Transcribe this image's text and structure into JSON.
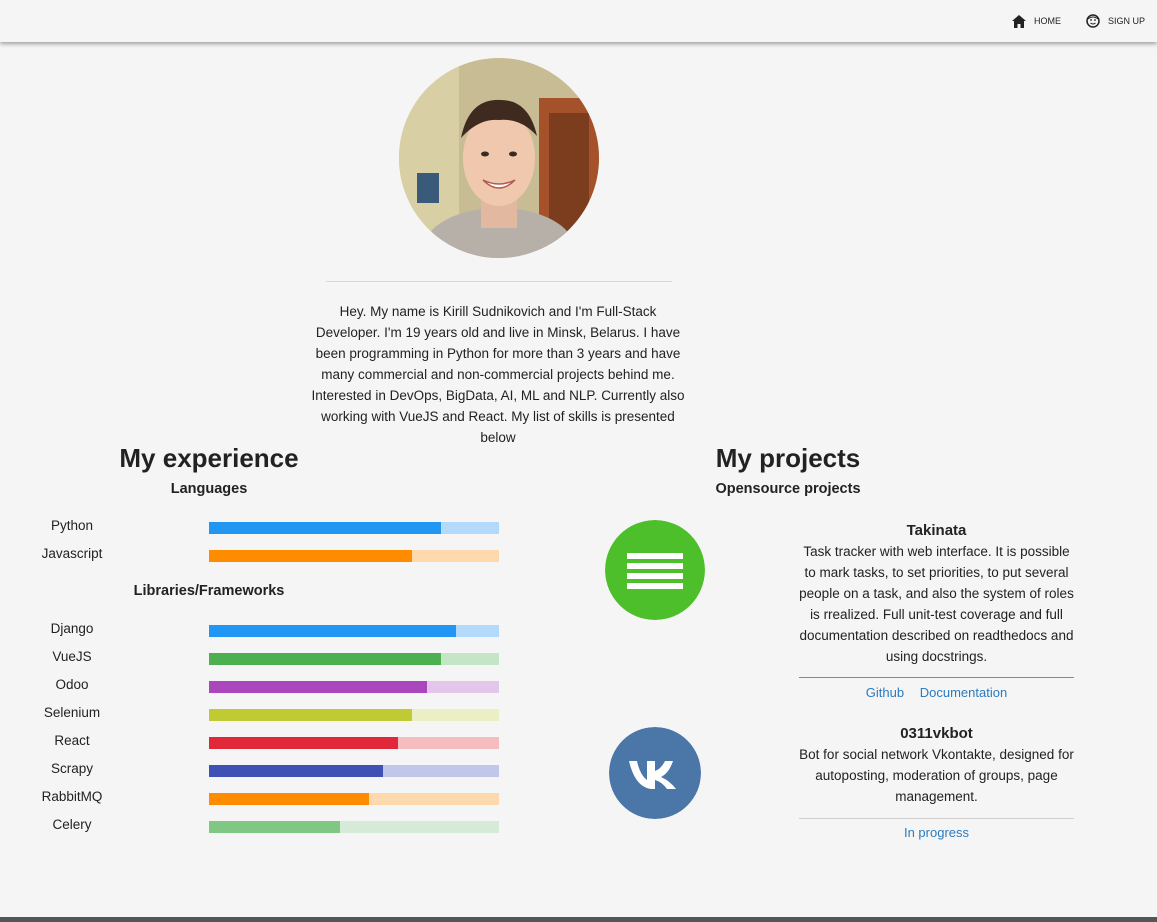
{
  "nav": {
    "home_label": "HOME",
    "signup_label": "SIGN UP"
  },
  "bio": "Hey. My name is Kirill Sudnikovich and I'm Full-Stack Developer. I'm 19 years old and live in Minsk, Belarus. I have been programming in Python for more than 3 years and have many commercial and non-commercial projects behind me. Interested in DevOps, BigData, AI, ML and NLP. Currently also working with VueJS and React. My list of skills is presented below",
  "experience": {
    "title": "My experience",
    "languages_heading": "Languages",
    "languages": [
      {
        "name": "Python",
        "level": 0.8,
        "color": "#2196f3",
        "track": "#b3dafb"
      },
      {
        "name": "Javascript",
        "level": 0.7,
        "color": "#ff8c00",
        "track": "#fdd9ad"
      }
    ],
    "frameworks_heading": "Libraries/Frameworks",
    "frameworks": [
      {
        "name": "Django",
        "level": 0.85,
        "color": "#2196f3",
        "track": "#b3dafb"
      },
      {
        "name": "VueJS",
        "level": 0.8,
        "color": "#4caf50",
        "track": "#c5e6c6"
      },
      {
        "name": "Odoo",
        "level": 0.75,
        "color": "#ab47bc",
        "track": "#e3c6ea"
      },
      {
        "name": "Selenium",
        "level": 0.7,
        "color": "#c0ca33",
        "track": "#ecefc4"
      },
      {
        "name": "React",
        "level": 0.65,
        "color": "#e0283a",
        "track": "#f6bdc1"
      },
      {
        "name": "Scrapy",
        "level": 0.6,
        "color": "#3f51b5",
        "track": "#c1c7e8"
      },
      {
        "name": "RabbitMQ",
        "level": 0.55,
        "color": "#ff8c00",
        "track": "#fdd9ad"
      },
      {
        "name": "Celery",
        "level": 0.45,
        "color": "#81c784",
        "track": "#d6ebd7"
      }
    ]
  },
  "projects": {
    "title": "My projects",
    "heading": "Opensource projects",
    "items": [
      {
        "name": "Takinata",
        "icon": "list-icon",
        "description": "Task tracker with web interface. It is possible to mark tasks, to set priorities, to put several people on a task, and also the system of roles is rrealized. Full unit-test coverage and full documentation described on readthedocs and using docstrings.",
        "link_github": "Github",
        "link_docs": "Documentation"
      },
      {
        "name": "0311vkbot",
        "icon": "vk-icon",
        "description": "Bot for social network Vkontakte, designed for autoposting, moderation of groups, page management.",
        "status": "In progress"
      }
    ]
  },
  "colors": {
    "link": "#2a7bc0",
    "takinata_icon": "#4cbf2a",
    "vk_icon": "#4a76a8"
  }
}
